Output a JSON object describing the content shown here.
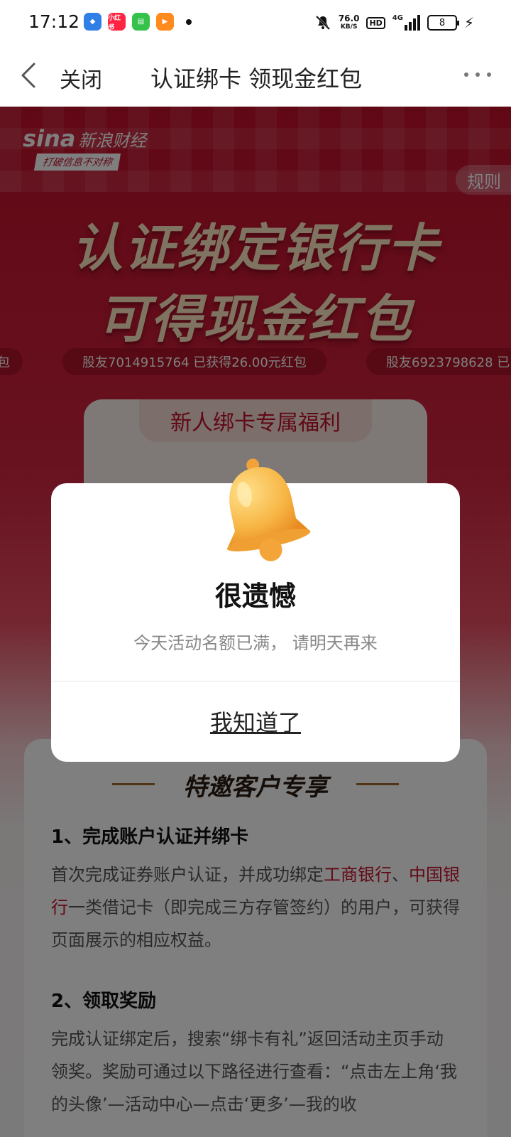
{
  "status_bar": {
    "time": "17:12",
    "net_speed": "76.0",
    "net_unit": "KB/S",
    "hd": "HD",
    "network": "4G",
    "battery": "8",
    "apps": [
      "app-icon-1",
      "小红书",
      "chat-app-icon",
      "video-app-icon"
    ]
  },
  "nav": {
    "close_label": "关闭",
    "title": "认证绑卡 领现金红包"
  },
  "page": {
    "brand": "sina",
    "brand_name": "新浪财经",
    "slogan": "打破信息不对称",
    "rules_label": "规则",
    "hero_line1": "认证绑定银行卡",
    "hero_line2": "可得现金红包",
    "ticker": [
      "红包",
      "股友7014915764 已获得26.00元红包",
      "股友6923798628 已"
    ],
    "welfare_title": "新人绑卡专属福利",
    "rules_heading": "特邀客户专享",
    "step1_title": "1、完成账户认证并绑卡",
    "step1_body_a": "首次完成证券账户认证，并成功绑定",
    "step1_bank1": "工商银行",
    "step1_sep": "、",
    "step1_bank2": "中国银行",
    "step1_body_b": "一类借记卡（即完成三方存管签约）的用户，可获得页面展示的相应权益。",
    "step2_title": "2、领取奖励",
    "step2_body": "完成认证绑定后，搜索“绑卡有礼”返回活动主页手动领奖。奖励可通过以下路径进行查看：“点击左上角‘我的头像’—活动中心—点击‘更多’—我的收"
  },
  "modal": {
    "title": "很遗憾",
    "message": "今天活动名额已满， 请明天再来",
    "button": "我知道了"
  },
  "colors": {
    "brand_red": "#c3102b",
    "bell": "#f7b544"
  }
}
